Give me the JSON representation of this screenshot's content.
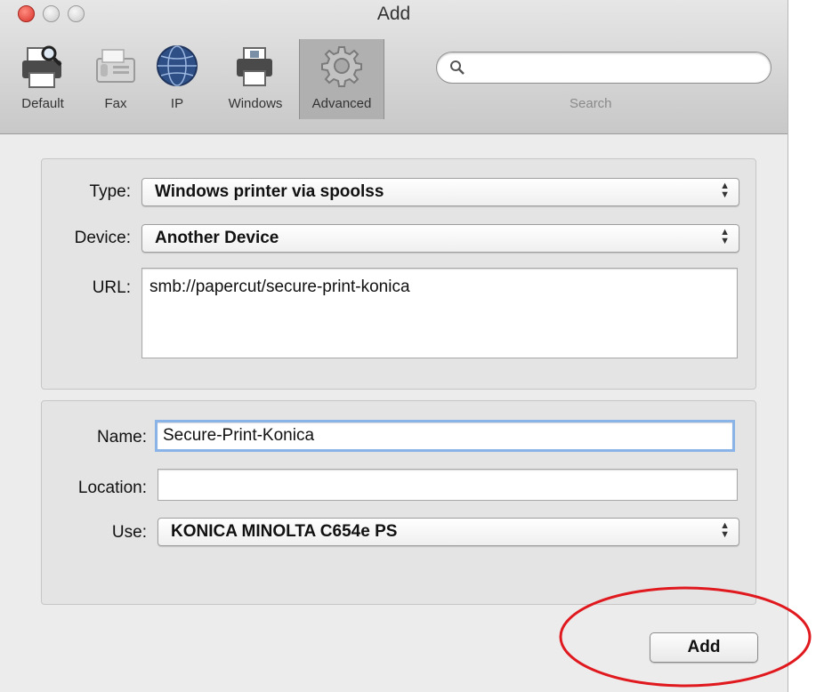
{
  "window": {
    "title": "Add"
  },
  "toolbar": {
    "items": [
      {
        "label": "Default",
        "icon": "printer-magnifier-icon"
      },
      {
        "label": "Fax",
        "icon": "fax-icon"
      },
      {
        "label": "IP",
        "icon": "globe-icon"
      },
      {
        "label": "Windows",
        "icon": "windows-printer-icon"
      },
      {
        "label": "Advanced",
        "icon": "gear-icon",
        "selected": true
      }
    ],
    "search": {
      "label": "Search",
      "value": "",
      "icon": "search-icon"
    }
  },
  "advanced": {
    "type": {
      "label": "Type:",
      "value": "Windows printer via spoolss"
    },
    "device": {
      "label": "Device:",
      "value": "Another Device"
    },
    "url": {
      "label": "URL:",
      "value": "smb://papercut/secure-print-konica"
    }
  },
  "printer": {
    "name": {
      "label": "Name:",
      "value": "Secure-Print-Konica"
    },
    "location": {
      "label": "Location:",
      "value": ""
    },
    "use": {
      "label": "Use:",
      "value": "KONICA MINOLTA C654e PS"
    }
  },
  "actions": {
    "add_label": "Add"
  },
  "colors": {
    "highlight_ring": "#e0191f",
    "focus_ring": "#8ab4e8"
  }
}
